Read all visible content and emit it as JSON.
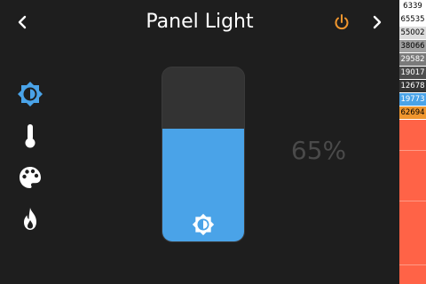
{
  "header": {
    "title": "Panel Light",
    "prev_icon": "chevron-left-icon",
    "next_icon": "chevron-right-icon",
    "power_icon": "power-icon",
    "power_color": "#f0962e"
  },
  "modes": [
    {
      "icon": "brightness-icon",
      "color": "#4aa3e8",
      "active": true
    },
    {
      "icon": "thermometer-icon",
      "color": "#ffffff",
      "active": false
    },
    {
      "icon": "palette-icon",
      "color": "#ffffff",
      "active": false
    },
    {
      "icon": "flame-icon",
      "color": "#ffffff",
      "active": false
    }
  ],
  "brightness": {
    "value_percent": 65,
    "label": "65%",
    "fill_color": "#4aa3e8",
    "icon": "brightness-icon"
  },
  "color_bar": {
    "items": [
      {
        "label": "6339",
        "bg": "#ffffff",
        "fg": "#000000"
      },
      {
        "label": "65535",
        "bg": "#ffffff",
        "fg": "#000000"
      },
      {
        "label": "55002",
        "bg": "#dcdcdc",
        "fg": "#000000"
      },
      {
        "label": "38066",
        "bg": "#9e9e9e",
        "fg": "#000000"
      },
      {
        "label": "29582",
        "bg": "#7a7a7a",
        "fg": "#ffffff"
      },
      {
        "label": "19017",
        "bg": "#4d4d4d",
        "fg": "#ffffff"
      },
      {
        "label": "12678",
        "bg": "#333333",
        "fg": "#ffffff"
      },
      {
        "label": "19773",
        "bg": "#4aa3e8",
        "fg": "#ffffff"
      },
      {
        "label": "62694",
        "bg": "#f0962e",
        "fg": "#000000"
      }
    ],
    "remainder_color": "#ff6347"
  }
}
